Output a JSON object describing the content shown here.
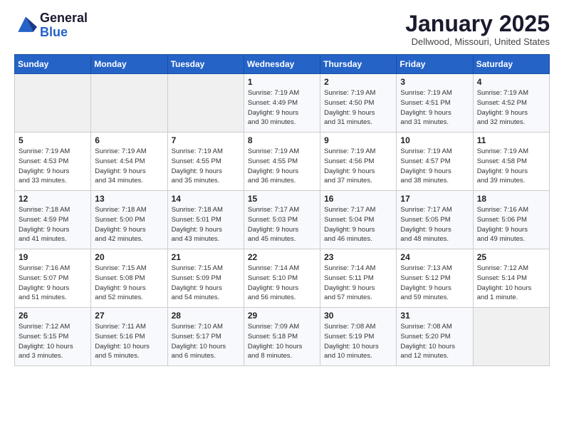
{
  "header": {
    "logo_general": "General",
    "logo_blue": "Blue",
    "month_title": "January 2025",
    "location": "Dellwood, Missouri, United States"
  },
  "weekdays": [
    "Sunday",
    "Monday",
    "Tuesday",
    "Wednesday",
    "Thursday",
    "Friday",
    "Saturday"
  ],
  "weeks": [
    [
      {
        "day": "",
        "info": ""
      },
      {
        "day": "",
        "info": ""
      },
      {
        "day": "",
        "info": ""
      },
      {
        "day": "1",
        "info": "Sunrise: 7:19 AM\nSunset: 4:49 PM\nDaylight: 9 hours\nand 30 minutes."
      },
      {
        "day": "2",
        "info": "Sunrise: 7:19 AM\nSunset: 4:50 PM\nDaylight: 9 hours\nand 31 minutes."
      },
      {
        "day": "3",
        "info": "Sunrise: 7:19 AM\nSunset: 4:51 PM\nDaylight: 9 hours\nand 31 minutes."
      },
      {
        "day": "4",
        "info": "Sunrise: 7:19 AM\nSunset: 4:52 PM\nDaylight: 9 hours\nand 32 minutes."
      }
    ],
    [
      {
        "day": "5",
        "info": "Sunrise: 7:19 AM\nSunset: 4:53 PM\nDaylight: 9 hours\nand 33 minutes."
      },
      {
        "day": "6",
        "info": "Sunrise: 7:19 AM\nSunset: 4:54 PM\nDaylight: 9 hours\nand 34 minutes."
      },
      {
        "day": "7",
        "info": "Sunrise: 7:19 AM\nSunset: 4:55 PM\nDaylight: 9 hours\nand 35 minutes."
      },
      {
        "day": "8",
        "info": "Sunrise: 7:19 AM\nSunset: 4:55 PM\nDaylight: 9 hours\nand 36 minutes."
      },
      {
        "day": "9",
        "info": "Sunrise: 7:19 AM\nSunset: 4:56 PM\nDaylight: 9 hours\nand 37 minutes."
      },
      {
        "day": "10",
        "info": "Sunrise: 7:19 AM\nSunset: 4:57 PM\nDaylight: 9 hours\nand 38 minutes."
      },
      {
        "day": "11",
        "info": "Sunrise: 7:19 AM\nSunset: 4:58 PM\nDaylight: 9 hours\nand 39 minutes."
      }
    ],
    [
      {
        "day": "12",
        "info": "Sunrise: 7:18 AM\nSunset: 4:59 PM\nDaylight: 9 hours\nand 41 minutes."
      },
      {
        "day": "13",
        "info": "Sunrise: 7:18 AM\nSunset: 5:00 PM\nDaylight: 9 hours\nand 42 minutes."
      },
      {
        "day": "14",
        "info": "Sunrise: 7:18 AM\nSunset: 5:01 PM\nDaylight: 9 hours\nand 43 minutes."
      },
      {
        "day": "15",
        "info": "Sunrise: 7:17 AM\nSunset: 5:03 PM\nDaylight: 9 hours\nand 45 minutes."
      },
      {
        "day": "16",
        "info": "Sunrise: 7:17 AM\nSunset: 5:04 PM\nDaylight: 9 hours\nand 46 minutes."
      },
      {
        "day": "17",
        "info": "Sunrise: 7:17 AM\nSunset: 5:05 PM\nDaylight: 9 hours\nand 48 minutes."
      },
      {
        "day": "18",
        "info": "Sunrise: 7:16 AM\nSunset: 5:06 PM\nDaylight: 9 hours\nand 49 minutes."
      }
    ],
    [
      {
        "day": "19",
        "info": "Sunrise: 7:16 AM\nSunset: 5:07 PM\nDaylight: 9 hours\nand 51 minutes."
      },
      {
        "day": "20",
        "info": "Sunrise: 7:15 AM\nSunset: 5:08 PM\nDaylight: 9 hours\nand 52 minutes."
      },
      {
        "day": "21",
        "info": "Sunrise: 7:15 AM\nSunset: 5:09 PM\nDaylight: 9 hours\nand 54 minutes."
      },
      {
        "day": "22",
        "info": "Sunrise: 7:14 AM\nSunset: 5:10 PM\nDaylight: 9 hours\nand 56 minutes."
      },
      {
        "day": "23",
        "info": "Sunrise: 7:14 AM\nSunset: 5:11 PM\nDaylight: 9 hours\nand 57 minutes."
      },
      {
        "day": "24",
        "info": "Sunrise: 7:13 AM\nSunset: 5:12 PM\nDaylight: 9 hours\nand 59 minutes."
      },
      {
        "day": "25",
        "info": "Sunrise: 7:12 AM\nSunset: 5:14 PM\nDaylight: 10 hours\nand 1 minute."
      }
    ],
    [
      {
        "day": "26",
        "info": "Sunrise: 7:12 AM\nSunset: 5:15 PM\nDaylight: 10 hours\nand 3 minutes."
      },
      {
        "day": "27",
        "info": "Sunrise: 7:11 AM\nSunset: 5:16 PM\nDaylight: 10 hours\nand 5 minutes."
      },
      {
        "day": "28",
        "info": "Sunrise: 7:10 AM\nSunset: 5:17 PM\nDaylight: 10 hours\nand 6 minutes."
      },
      {
        "day": "29",
        "info": "Sunrise: 7:09 AM\nSunset: 5:18 PM\nDaylight: 10 hours\nand 8 minutes."
      },
      {
        "day": "30",
        "info": "Sunrise: 7:08 AM\nSunset: 5:19 PM\nDaylight: 10 hours\nand 10 minutes."
      },
      {
        "day": "31",
        "info": "Sunrise: 7:08 AM\nSunset: 5:20 PM\nDaylight: 10 hours\nand 12 minutes."
      },
      {
        "day": "",
        "info": ""
      }
    ]
  ]
}
